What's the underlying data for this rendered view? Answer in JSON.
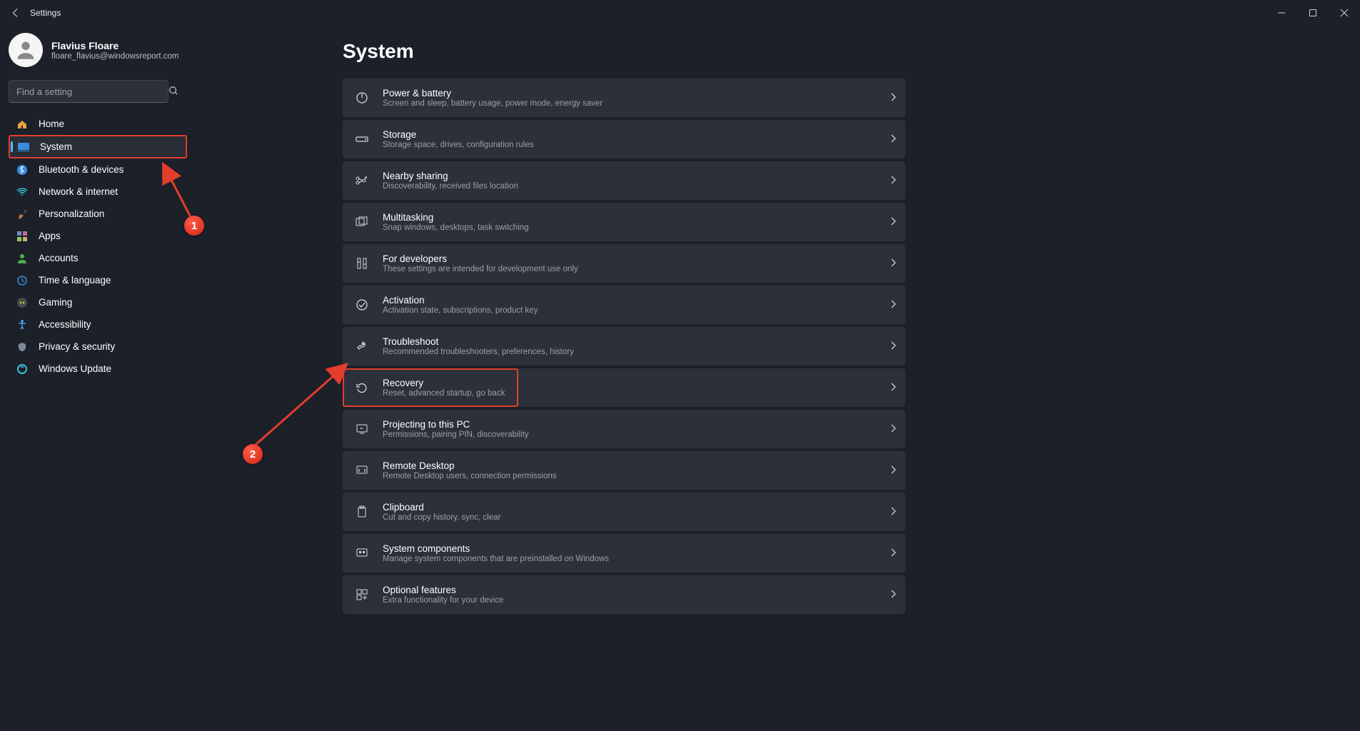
{
  "window": {
    "title": "Settings"
  },
  "profile": {
    "name": "Flavius Floare",
    "email": "floare_flavius@windowsreport.com"
  },
  "search": {
    "placeholder": "Find a setting"
  },
  "sidebar": {
    "items": [
      {
        "label": "Home"
      },
      {
        "label": "System"
      },
      {
        "label": "Bluetooth & devices"
      },
      {
        "label": "Network & internet"
      },
      {
        "label": "Personalization"
      },
      {
        "label": "Apps"
      },
      {
        "label": "Accounts"
      },
      {
        "label": "Time & language"
      },
      {
        "label": "Gaming"
      },
      {
        "label": "Accessibility"
      },
      {
        "label": "Privacy & security"
      },
      {
        "label": "Windows Update"
      }
    ]
  },
  "main": {
    "title": "System",
    "cards": [
      {
        "title": "Power & battery",
        "desc": "Screen and sleep, battery usage, power mode, energy saver"
      },
      {
        "title": "Storage",
        "desc": "Storage space, drives, configuration rules"
      },
      {
        "title": "Nearby sharing",
        "desc": "Discoverability, received files location"
      },
      {
        "title": "Multitasking",
        "desc": "Snap windows, desktops, task switching"
      },
      {
        "title": "For developers",
        "desc": "These settings are intended for development use only"
      },
      {
        "title": "Activation",
        "desc": "Activation state, subscriptions, product key"
      },
      {
        "title": "Troubleshoot",
        "desc": "Recommended troubleshooters, preferences, history"
      },
      {
        "title": "Recovery",
        "desc": "Reset, advanced startup, go back"
      },
      {
        "title": "Projecting to this PC",
        "desc": "Permissions, pairing PIN, discoverability"
      },
      {
        "title": "Remote Desktop",
        "desc": "Remote Desktop users, connection permissions"
      },
      {
        "title": "Clipboard",
        "desc": "Cut and copy history, sync, clear"
      },
      {
        "title": "System components",
        "desc": "Manage system components that are preinstalled on Windows"
      },
      {
        "title": "Optional features",
        "desc": "Extra functionality for your device"
      }
    ]
  },
  "annotations": {
    "badge1": "1",
    "badge2": "2"
  }
}
